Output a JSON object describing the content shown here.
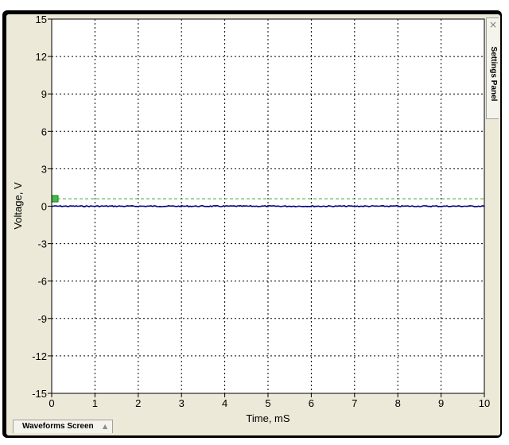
{
  "window": {
    "settings_panel_label": "Settings Panel",
    "close_glyph": "×",
    "waveforms_tab_label": "Waveforms Screen",
    "waveforms_tab_arrow": "▲"
  },
  "chart_data": {
    "type": "line",
    "xlabel": "Time, mS",
    "ylabel": "Voltage, V",
    "xlim": [
      0,
      10
    ],
    "ylim": [
      -15,
      15
    ],
    "x_ticks": [
      0,
      1,
      2,
      3,
      4,
      5,
      6,
      7,
      8,
      9,
      10
    ],
    "y_ticks": [
      15,
      12,
      9,
      6,
      3,
      0,
      -3,
      -6,
      -9,
      -12,
      -15
    ],
    "grid": true,
    "trigger_level": 0.6,
    "colors": {
      "trace": "#000080",
      "trigger": "#33aa33",
      "grid": "#000000",
      "plot_bg": "#ffffff"
    },
    "series": [
      {
        "x": [
          0,
          10
        ],
        "y": [
          0,
          0
        ]
      }
    ]
  }
}
